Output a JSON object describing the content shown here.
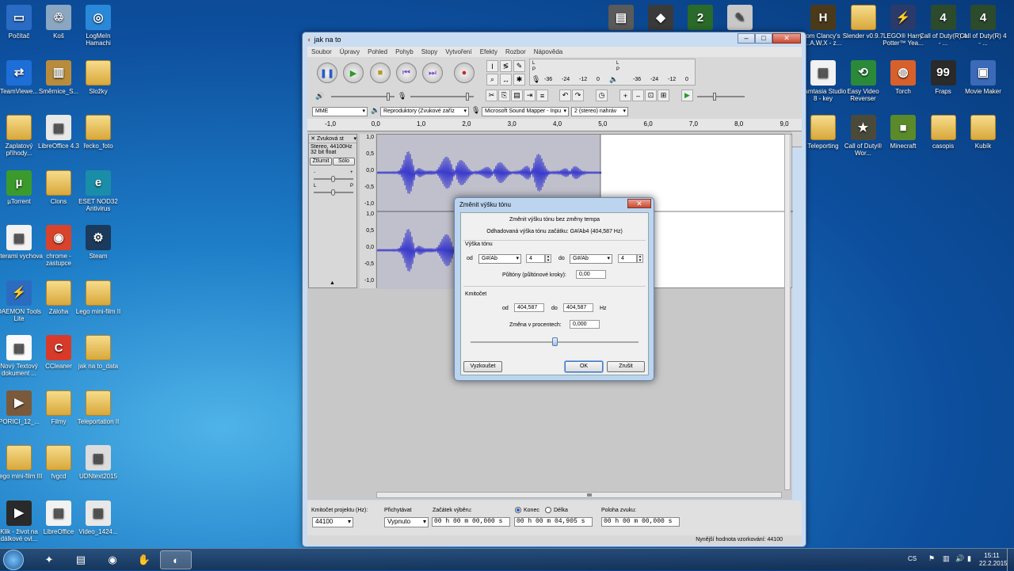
{
  "desktop_left": [
    {
      "label": "Počítač",
      "icon": "computer-icon",
      "sym": "▭",
      "color": "#2a6cc4"
    },
    {
      "label": "Koš",
      "icon": "recycle-bin-icon",
      "sym": "♲",
      "color": "#8aa6c0"
    },
    {
      "label": "LogMeIn Hamachi",
      "icon": "hamachi-icon",
      "sym": "◎",
      "color": "#2a88d8"
    },
    {
      "label": "TeamViewe...",
      "icon": "teamviewer-icon",
      "sym": "⇄",
      "color": "#1e6ed8"
    },
    {
      "label": "Směrnice_S...",
      "icon": "books-icon",
      "sym": "▥",
      "color": "#b88c3c"
    },
    {
      "label": "Složky",
      "icon": "folder-icon",
      "sym": "",
      "color": "folder"
    },
    {
      "label": "Zaplatový příhody...",
      "icon": "folder-icon",
      "sym": "",
      "color": "folder"
    },
    {
      "label": "LibreOffice 4.3",
      "icon": "document-icon",
      "sym": "▤",
      "color": "#e8e8e8"
    },
    {
      "label": "řecko_foto",
      "icon": "folder-icon",
      "sym": "",
      "color": "folder"
    },
    {
      "label": "µTorrent",
      "icon": "utorrent-icon",
      "sym": "µ",
      "color": "#3a9a2c"
    },
    {
      "label": "Clons",
      "icon": "folder-icon",
      "sym": "",
      "color": "folder"
    },
    {
      "label": "ESET NOD32 Antivirus",
      "icon": "eset-icon",
      "sym": "e",
      "color": "#1a8ea8"
    },
    {
      "label": "Literami vychova",
      "icon": "document-icon",
      "sym": "▤",
      "color": "#f2f2f2"
    },
    {
      "label": "chrome - zastupce",
      "icon": "chrome-icon",
      "sym": "◉",
      "color": "#d8432c"
    },
    {
      "label": "Steam",
      "icon": "steam-icon",
      "sym": "⚙",
      "color": "#1b3a5c"
    },
    {
      "label": "DAEMON Tools Lite",
      "icon": "daemon-icon",
      "sym": "⚡",
      "color": "#2c6cc0"
    },
    {
      "label": "Záloha",
      "icon": "folder-icon",
      "sym": "",
      "color": "folder"
    },
    {
      "label": "Lego mini-film II",
      "icon": "folder-icon",
      "sym": "",
      "color": "folder"
    },
    {
      "label": "Nový Textový dokument ...",
      "icon": "text-file-icon",
      "sym": "▤",
      "color": "#fafafa"
    },
    {
      "label": "CCleaner",
      "icon": "ccleaner-icon",
      "sym": "C",
      "color": "#d83a2a"
    },
    {
      "label": "jak na to_data",
      "icon": "folder-icon",
      "sym": "",
      "color": "folder"
    },
    {
      "label": "PORICI_12_...",
      "icon": "video-icon",
      "sym": "▶",
      "color": "#7a5a3a"
    },
    {
      "label": "Filmy",
      "icon": "folder-icon",
      "sym": "",
      "color": "folder"
    },
    {
      "label": "Teleportation II",
      "icon": "folder-icon",
      "sym": "",
      "color": "folder"
    },
    {
      "label": "Lego mini-film III",
      "icon": "folder-icon",
      "sym": "",
      "color": "folder"
    },
    {
      "label": "fvgcd",
      "icon": "folder-icon",
      "sym": "",
      "color": "folder"
    },
    {
      "label": "UDNtext2015",
      "icon": "image-icon",
      "sym": "▦",
      "color": "#dcdcdc"
    },
    {
      "label": "Klik - život na dálkové ovl...",
      "icon": "video-icon",
      "sym": "▶",
      "color": "#2a2a2a"
    },
    {
      "label": "LibreOffice",
      "icon": "document-icon",
      "sym": "▤",
      "color": "#f2f2f2"
    },
    {
      "label": "Video_1424...",
      "icon": "qr-icon",
      "sym": "▩",
      "color": "#e8e8e8"
    }
  ],
  "desktop_right": [
    {
      "label": "om Clancy's ...A.W.X - z...",
      "icon": "hawx-icon",
      "sym": "H",
      "color": "#4a3a1a"
    },
    {
      "label": "Slender v0.9.7",
      "icon": "folder-icon",
      "sym": "",
      "color": "folder"
    },
    {
      "label": "LEGO® Harry Potter™ Yea...",
      "icon": "lego-hp-icon",
      "sym": "⚡",
      "color": "#2a3a6a"
    },
    {
      "label": "Call of Duty(R) 4 - ...",
      "icon": "cod4-icon",
      "sym": "4",
      "color": "#2c4a2c"
    },
    {
      "label": "Call of Duty(R) 4 - ...",
      "icon": "cod4-icon",
      "sym": "4",
      "color": "#2c4a2c"
    },
    {
      "label": "Camtasia Studio 8 - key",
      "icon": "document-icon",
      "sym": "▤",
      "color": "#f2f2f2"
    },
    {
      "label": "Easy Video Reverser",
      "icon": "reverse-arrow-icon",
      "sym": "⟲",
      "color": "#2a8a3a"
    },
    {
      "label": "Torch",
      "icon": "torch-icon",
      "sym": "◍",
      "color": "#d8602a"
    },
    {
      "label": "Fraps",
      "icon": "fraps-icon",
      "sym": "99",
      "color": "#2a2a2a"
    },
    {
      "label": "Movie Maker",
      "icon": "movie-maker-icon",
      "sym": "▣",
      "color": "#3a6ab8"
    },
    {
      "label": "Teleporting",
      "icon": "folder-icon",
      "sym": "",
      "color": "folder"
    },
    {
      "label": "Call of Duty® Wor...",
      "icon": "cod-waw-icon",
      "sym": "★",
      "color": "#4a4a3a"
    },
    {
      "label": "Minecraft",
      "icon": "minecraft-icon",
      "sym": "■",
      "color": "#5a8a2a"
    },
    {
      "label": "casopis",
      "icon": "folder-icon",
      "sym": "",
      "color": "folder"
    },
    {
      "label": "Kubík",
      "icon": "folder-icon",
      "sym": "",
      "color": "folder"
    }
  ],
  "desktop_top": [
    {
      "icon": "media-icon",
      "sym": "▤",
      "color": "#5a5a5a"
    },
    {
      "icon": "game-icon",
      "sym": "◆",
      "color": "#3a3a3a"
    },
    {
      "icon": "game2-icon",
      "sym": "2",
      "color": "#2a6a2a"
    },
    {
      "icon": "paint-icon",
      "sym": "✎",
      "color": "#c8c8c8"
    }
  ],
  "app": {
    "title": "jak na to",
    "menu": [
      "Soubor",
      "Úpravy",
      "Pohled",
      "Pohyb",
      "Stopy",
      "Vytvoření",
      "Efekty",
      "Rozbor",
      "Nápověda"
    ],
    "meter_ticks": [
      "-36",
      "-24",
      "-12",
      "0"
    ],
    "meter_ticks_play": [
      "-36",
      "-24",
      "-12",
      "0"
    ],
    "meter_lr": [
      "L",
      "P"
    ],
    "host": "MME",
    "output_device": "Reproduktory (Zvukové zaříz",
    "input_device": "Microsoft Sound Mapper - Inpu",
    "channels": "2 (stereo) nahráv",
    "ruler": [
      "-1,0",
      "0,0",
      "1,0",
      "2,0",
      "3,0",
      "4,0",
      "5,0",
      "6,0",
      "7,0",
      "8,0",
      "9,0"
    ],
    "track": {
      "name": "Zvuková st",
      "info1": "Stereo, 44100Hz",
      "info2": "32 bit float",
      "mute": "Ztlumit",
      "solo": "Sólo",
      "scale": [
        "1,0",
        "0,5",
        "0,0",
        "-0,5",
        "-1,0"
      ],
      "gain_lr": [
        "L",
        "P"
      ],
      "gain_pm": [
        "-",
        "+"
      ]
    },
    "bottom": {
      "rate_label": "Kmitočet projektu (Hz):",
      "rate": "44100",
      "snap_label": "Přichytávat",
      "snap": "Vypnuto",
      "sel_start_label": "Začátek výběru:",
      "end_label": "Konec",
      "length_label": "Délka",
      "pos_label": "Poloha zvuku:",
      "sel_start": "00 h 00 m 00,000 s",
      "sel_end": "00 h 00 m 04,905 s",
      "pos": "00 h 00 m 00,000 s"
    },
    "status": "Nynější hodnota vzorkování: 44100"
  },
  "dialog": {
    "title": "Změnit výšku tónu",
    "subtitle": "Změnit výšku tónu bez změny tempa",
    "estimate": "Odhadovaná výška tónu začátku: G#/Ab4 (404,587 Hz)",
    "pitch_section": "Výška tónu",
    "from": "od",
    "to": "do",
    "pitch_from": "G#/Ab",
    "oct_from": "4",
    "pitch_to": "G#/Ab",
    "oct_to": "4",
    "semitones_label": "Půltóny (půltónové kroky):",
    "semitones": "0,00",
    "freq_section": "Kmitočet",
    "freq_from": "404,587",
    "freq_to": "404,587",
    "hz": "Hz",
    "percent_label": "Změna v procentech:",
    "percent": "0,000",
    "percent_slider": 0.5,
    "preview": "Vyzkoušet",
    "ok": "OK",
    "cancel": "Zrušit"
  },
  "taskbar": {
    "lang": "CS",
    "time": "15:11",
    "date": "22.2.2015"
  }
}
